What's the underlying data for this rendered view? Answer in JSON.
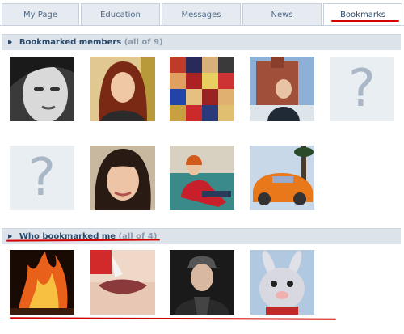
{
  "tabs": [
    {
      "label": "My Page"
    },
    {
      "label": "Education"
    },
    {
      "label": "Messages"
    },
    {
      "label": "News"
    },
    {
      "label": "Bookmarks",
      "active": true
    }
  ],
  "bookmarked_members": {
    "title": "Bookmarked members",
    "count": "(all of 9)"
  },
  "who_bookmarked_me": {
    "title": "Who bookmarked me",
    "count": "(all of 4)"
  },
  "placeholder_glyph": "?",
  "colors": {
    "accent_red": "#d20000",
    "header_bg": "#dde3ea",
    "header_text": "#2b4a6b"
  }
}
